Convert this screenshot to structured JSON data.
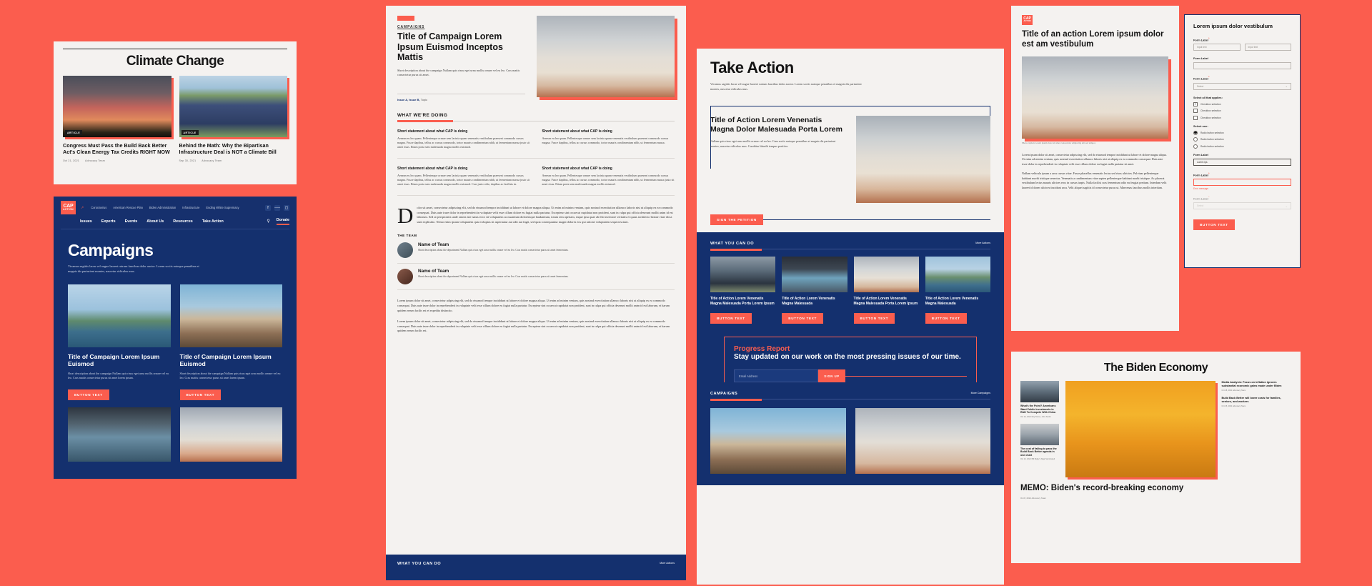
{
  "brand": {
    "accent_red": "#fb5d4e",
    "navy": "#14306e",
    "paper": "#f4f2f0",
    "logo_top": "CAP",
    "logo_bottom": "ACTION"
  },
  "climate_panel": {
    "title": "Climate Change",
    "cards": [
      {
        "tag": "ARTICLE",
        "title": "Congress Must Pass the Build Back Better Act's Clean Energy Tax Credits RIGHT NOW",
        "date": "Oct 21, 2021",
        "author": "Advocacy Team"
      },
      {
        "tag": "ARTICLE",
        "title": "Behind the Math: Why the Bipartisan Infrastructure Deal is NOT a Climate Bill",
        "date": "Sep 30, 2021",
        "author": "Advocacy Team"
      }
    ]
  },
  "nav": {
    "top_links": [
      "Coronavirus",
      "American Rescue Plan",
      "Biden Administration",
      "Infrastructure",
      "Ending White Supremacy"
    ],
    "main_links": [
      "Issues",
      "Experts",
      "Events",
      "About Us",
      "Resources",
      "Take Action"
    ],
    "social": [
      "facebook-icon",
      "twitter-icon",
      "instagram-icon"
    ],
    "search_icon": "search-icon",
    "donate": "Donate"
  },
  "campaigns_panel": {
    "title": "Campaigns",
    "intro": "Vivamus sagittis lacus vel augue laoreet rutrum faucibus dolor auctor. Lorem sociis natoque penatibus et magnis dis parturient montes, nascetur ridiculus mus.",
    "cards": [
      {
        "title": "Title of Campaign Lorem Ipsum Euismod",
        "desc": "Short description about the campaign Nullam quis risus eget urna mollis ornare vel eu leo. Cras mattis consectetur purus sit amet lorem ipsum.",
        "button": "BUTTON TEXT"
      },
      {
        "title": "Title of Campaign Lorem Ipsum Euismod",
        "desc": "Short description about the campaign Nullam quis risus eget urna mollis ornare vel eu leo. Cras mattis consectetur purus sit amet lorem ipsum.",
        "button": "BUTTON TEXT"
      }
    ]
  },
  "article_panel": {
    "eyebrow": "CAMPAIGNS",
    "title": "Title of Campaign Lorem Ipsum Euismod Inceptos Mattis",
    "desc": "Short description about the campaign Nullam quis risus eget urna mollis ornare vel eu leo. Cras mattis consectetur purus sit amet.",
    "issues_label": "Issue A, Issue B,",
    "issues_topic": "Topic",
    "section_heading": "WHAT WE'RE DOING",
    "statements": [
      {
        "title": "Short statement about what CAP is doing",
        "body": "Aenean eu leo quam. Pellentesque ornare sem lacinia quam venenatis vestibulum praesent commodo cursus magna. Fusce dapibus, tellus ac cursus commodo, tortor mauris condimentum nibh, ut fermentum massa justo sit amet risus. Etiam porta sem malesuada magna mollis euismod."
      },
      {
        "title": "Short statement about what CAP is doing",
        "body": "Aenean eu leo quam. Pellentesque ornare sem lacinia quam venenatis vestibulum praesent commodo cursus magna. Fusce dapibus, tellus ac cursus commodo, tortor mauris condimentum nibh, ut fermentum massa."
      },
      {
        "title": "Short statement about what CAP is doing",
        "body": "Aenean eu leo quam. Pellentesque ornare sem lacinia quam venenatis vestibulum praesent commodo cursus magna. Fusce dapibus, tellus ac cursus commodo, tortor mauris condimentum nibh, ut fermentum massa justo sit amet risus. Etiam porta sem malesuada magna mollis euismod. Cras justo odio, dapibus ac facilisis in."
      },
      {
        "title": "Short statement about what CAP is doing",
        "body": "Aenean eu leo quam. Pellentesque ornare sem lacinia quam venenatis vestibulum praesent commodo cursus magna. Fusce dapibus, tellus ac cursus commodo, tortor mauris condimentum nibh, ut fermentum massa justo sit amet risus. Etiam porta sem malesuada magna mollis euismod."
      }
    ],
    "dropcap": "D",
    "dropcap_body": "olor sit amet, consectetur adipiscing elit, sed do eiusmod tempor incididunt ut labore et dolore magna aliqua. Ut enim ad minim veniam, quis nostrud exercitation ullamco laboris nisi ut aliquip ex ea commodo consequat. Duis aute irure dolor in reprehenderit in voluptate velit esse cillum dolore eu fugiat nulla pariatur. Excepteur sint occaecat cupidatat non proident, sunt in culpa qui officia deserunt mollit anim id est laborum. Sed ut perspiciatis unde omnis iste natus error sit voluptatem accusantium doloremque laudantium, totam rem aperiam, eaque ipsa quae ab illo inventore veritatis et quasi architecto beatae vitae dicta sunt explicabo. Nemo enim ipsam voluptatem quia voluptas sit aspernatur aut odit aut fugit, sed quia consequuntur magni dolores eos qui ratione voluptatem sequi nesciunt.",
    "team_heading": "THE TEAM",
    "team": [
      {
        "name": "Name of Team",
        "desc": "Short description about the department Nullam quis risus eget urna mollis ornare vel eu leo. Cras mattis consectetur purus sit amet fermentum."
      },
      {
        "name": "Name of Team",
        "desc": "Short description about the department Nullam quis risus eget urna mollis ornare vel eu leo. Cras mattis consectetur purus sit amet fermentum."
      }
    ],
    "long_copy": [
      "Lorem ipsum dolor sit amet, consectetur adipiscing elit, sed do eiusmod tempor incididunt ut labore et dolore magna aliqua. Ut enim ad minim veniam, quis nostrud exercitation ullamco laboris nisi ut aliquip ex ea commodo consequat. Duis aute irure dolor in reprehenderit in voluptate velit esse cillum dolore eu fugiat nulla pariatur. Excepteur sint occaecat cupidatat non proident, sunt in culpa qui officia deserunt mollit anim id est laborum, et harum quidem rerum facilis est et expedita distinctio.",
      "Lorem ipsum dolor sit amet, consectetur adipiscing elit, sed do eiusmod tempor incididunt ut labore et dolore magna aliqua. Ut enim ad minim veniam, quis nostrud exercitation ullamco laboris nisi ut aliquip ex ea commodo consequat. Duis aute irure dolor in reprehenderit in voluptate velit esse cillum dolore eu fugiat nulla pariatur. Excepteur sint occaecat cupidatat non proident, sunt in culpa qui officia deserunt mollit anim id est laborum, et harum quidem rerum facilis est."
    ],
    "footer_heading": "WHAT YOU CAN DO",
    "footer_more": "More Actions"
  },
  "takeaction_panel": {
    "title": "Take Action",
    "intro": "Vivamus sagittis lacus vel augue laoreet rutrum faucibus dolor auctor. Lorem sociis natoque penatibus et magnis dis parturient montes, nascetur ridiculus mus.",
    "feature": {
      "title": "Title of Action Lorem Venenatis Magna Dolor Malesuada Porta Lorem",
      "desc": "Nullam quis risus eget urna mollis ornare vel eu leo. Cum sociis natoque penatibus et magnis dis parturient montes, nascetur ridiculus mus. Curabitur blandit tempus porttitor.",
      "button": "SIGN THE PETITION"
    },
    "what_you_can_do": {
      "heading": "WHAT YOU CAN DO",
      "more": "More Actions",
      "cards": [
        {
          "title": "Title of Action Lorem Venenatis Magna Malesuada Porta Lorem Ipsum",
          "button": "BUTTON TEXT"
        },
        {
          "title": "Title of Action Lorem Venenatis Magna Malesuada",
          "button": "BUTTON TEXT"
        },
        {
          "title": "Title of Action Lorem Venenatis Magna Malesuada Porta Lorem Ipsum",
          "button": "BUTTON TEXT"
        },
        {
          "title": "Title of Action Lorem Venenatis Magna Malesuada",
          "button": "BUTTON TEXT"
        }
      ]
    },
    "progress_report": {
      "eyebrow": "Progress Report",
      "headline": "Stay updated on our work on the most pressing issues of our time.",
      "email_placeholder": "Email Address",
      "submit": "SIGN UP"
    },
    "campaigns": {
      "heading": "CAMPAIGNS",
      "more": "More Campaigns"
    }
  },
  "action_detail_panel": {
    "title": "Title of an action Lorem ipsum dolor est am vestibulum",
    "caption": "Photo caption Lorem ipsum dolor sit amet consectetur adipiscing elit sed tempor.",
    "body": [
      "Lorem ipsum dolor sit amet, consectetur adipiscing elit, sed do eiusmod tempor incididunt ut labore et dolore magna aliqua. Ut enim ad minim veniam, quis nostrud exercitation ullamco laboris nisi ut aliquip ex ea commodo consequat. Duis aute irure dolor in reprehenderit in voluptate velit esse cillum dolore eu fugiat nulla pariatur sit amet.",
      "Nullam vehicula ipsum a arcu cursus vitae. Fusce phasellus venenatis lectus sed risus ultricies. Pulvinar pellentesque habitant morbi tristique senectus. Venenatis a condimentum vitae sapien pellentesque habitant morbi tristique. Ac placerat vestibulum lectus mauris ultrices eros in cursus turpis. Nulla facilisi cras fermentum odio eu feugiat pretium. Interdum velit laoreet id donec ultrices tincidunt arcu. Velit aliquet sagittis id consectetur purus ut. Maecenas faucibus mollis interdum."
    ]
  },
  "form_panel": {
    "title": "Lorem ipsum dolor vestibulum",
    "fields": [
      {
        "label": "Form Label",
        "required": true,
        "type": "double-text",
        "placeholder_a": "Input text",
        "placeholder_b": "Input text"
      },
      {
        "label": "Form Label",
        "required": false,
        "type": "text",
        "value": ""
      },
      {
        "label": "Form Label",
        "required": true,
        "type": "select",
        "value": "Select"
      }
    ],
    "checkbox_group": {
      "label": "Select all that applies:",
      "options": [
        {
          "label": "Checkbox selection",
          "checked": true
        },
        {
          "label": "Checkbox selection",
          "checked": false
        },
        {
          "label": "Checkbox selection",
          "checked": false
        }
      ]
    },
    "radio_group": {
      "label": "Select one:",
      "options": [
        {
          "label": "Radio button selection",
          "selected": true
        },
        {
          "label": "Radio button selection",
          "selected": false
        },
        {
          "label": "Radio button selection",
          "selected": false
        }
      ]
    },
    "filled_field": {
      "label": "Form Label",
      "value": "Lorem ips"
    },
    "error_field": {
      "label": "Form Label",
      "required": true,
      "value": "",
      "error": "Error message"
    },
    "disabled_field": {
      "label": "Form Label",
      "required": true,
      "value": "Select"
    },
    "button": "BUTTON TEXT"
  },
  "biden_panel": {
    "title": "The Biden Economy",
    "headline": "MEMO: Biden's record-breaking economy",
    "headline_meta": "Oct 8, 2021     Advocacy Team",
    "left_items": [
      {
        "title": "What's the Point? Americans Want Public Investments in R&D To Compete With China",
        "date": "Oct 14, 2021",
        "author": "Roy Torres, John Smith"
      },
      {
        "title": "The cost of failing to pass the Build Back Better agenda in one chart",
        "date": "Oct 12, 2021",
        "author": "Bill Rigby's Nigel Vaccinated"
      }
    ],
    "right_items": [
      {
        "title": "Media Analysis: Focus on inflation ignores substantial economic gains made under Biden",
        "date": "Oct 18, 2021",
        "author": "Advocacy Team"
      },
      {
        "title": "Build Back Better will lower costs for families, seniors, and workers",
        "date": "Oct 15, 2021",
        "author": "Advocacy Team"
      }
    ]
  }
}
